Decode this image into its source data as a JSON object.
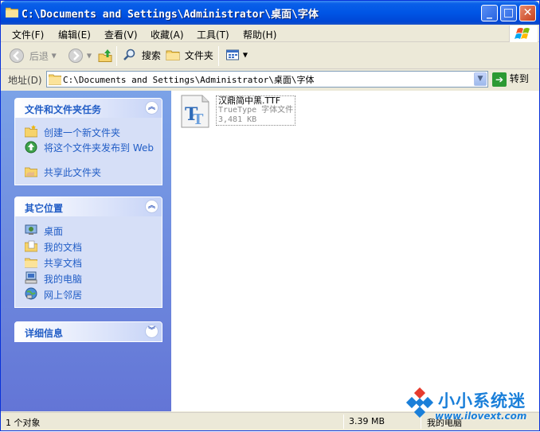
{
  "window": {
    "title": "C:\\Documents and Settings\\Administrator\\桌面\\字体",
    "minimize_glyph": "_",
    "maximize_glyph": "□",
    "close_glyph": "✕"
  },
  "menu": {
    "items": [
      "文件(F)",
      "编辑(E)",
      "查看(V)",
      "收藏(A)",
      "工具(T)",
      "帮助(H)"
    ]
  },
  "toolbar": {
    "back_label": "后退",
    "search_label": "搜索",
    "folders_label": "文件夹"
  },
  "address": {
    "label": "地址(D)",
    "value": "C:\\Documents and Settings\\Administrator\\桌面\\字体",
    "go_label": "转到"
  },
  "tasks_panel": {
    "title": "文件和文件夹任务",
    "items": [
      {
        "label": "创建一个新文件夹",
        "icon": "new-folder-icon"
      },
      {
        "label": "将这个文件夹发布到 Web",
        "icon": "publish-web-icon"
      },
      {
        "label": "共享此文件夹",
        "icon": "share-folder-icon"
      }
    ]
  },
  "places_panel": {
    "title": "其它位置",
    "items": [
      {
        "label": "桌面",
        "icon": "desktop-icon"
      },
      {
        "label": "我的文档",
        "icon": "my-documents-icon"
      },
      {
        "label": "共享文档",
        "icon": "shared-documents-icon"
      },
      {
        "label": "我的电脑",
        "icon": "my-computer-icon"
      },
      {
        "label": "网上邻居",
        "icon": "network-places-icon"
      }
    ]
  },
  "details_panel": {
    "title": "详细信息"
  },
  "files": [
    {
      "name": "汉鼎简中黑.TTF",
      "type": "TrueType 字体文件",
      "size": "3,481 KB",
      "icon": "truetype-font-icon"
    }
  ],
  "status": {
    "objects": "1 个对象",
    "size": "3.39 MB",
    "location": "我的电脑"
  },
  "watermark": {
    "brand": "小小系统迷",
    "url": "www.ilovext.com"
  },
  "colors": {
    "titlebar": "#0055e5",
    "panel_title": "#215dc6",
    "left_pane": "#7ba2e7",
    "watermark": "#1a7fd9"
  }
}
